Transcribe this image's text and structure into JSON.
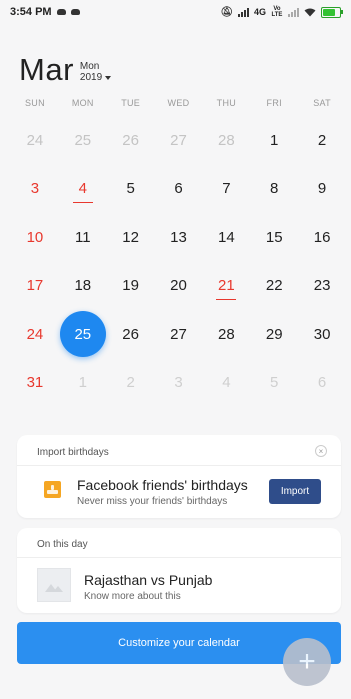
{
  "status_bar": {
    "time": "3:54 PM",
    "network": "4G",
    "volte": "Vo LTE"
  },
  "header": {
    "month": "Mar",
    "weekday": "Mon",
    "year": "2019"
  },
  "weekdays": [
    "SUN",
    "MON",
    "TUE",
    "WED",
    "THU",
    "FRI",
    "SAT"
  ],
  "calendar": {
    "selected_day": "25",
    "rows": [
      [
        "24",
        "25",
        "26",
        "27",
        "28",
        "1",
        "2"
      ],
      [
        "3",
        "4",
        "5",
        "6",
        "7",
        "8",
        "9"
      ],
      [
        "10",
        "11",
        "12",
        "13",
        "14",
        "15",
        "16"
      ],
      [
        "17",
        "18",
        "19",
        "20",
        "21",
        "22",
        "23"
      ],
      [
        "24",
        "25",
        "26",
        "27",
        "28",
        "29",
        "30"
      ],
      [
        "31",
        "1",
        "2",
        "3",
        "4",
        "5",
        "6"
      ]
    ]
  },
  "import_card": {
    "title": "Import birthdays",
    "close_glyph": "×",
    "item_title": "Facebook friends' birthdays",
    "item_subtitle": "Never miss your friends' birthdays",
    "button": "Import"
  },
  "on_this_day": {
    "title": "On this day",
    "item_title": "Rajasthan vs Punjab",
    "item_subtitle": "Know more about this"
  },
  "customize_button": "Customize your calendar",
  "fab_glyph": "+",
  "colors": {
    "accent": "#1e88f0",
    "holiday_red": "#e8382e",
    "import_button": "#2f4d8a",
    "customize": "#2b8ff0"
  }
}
